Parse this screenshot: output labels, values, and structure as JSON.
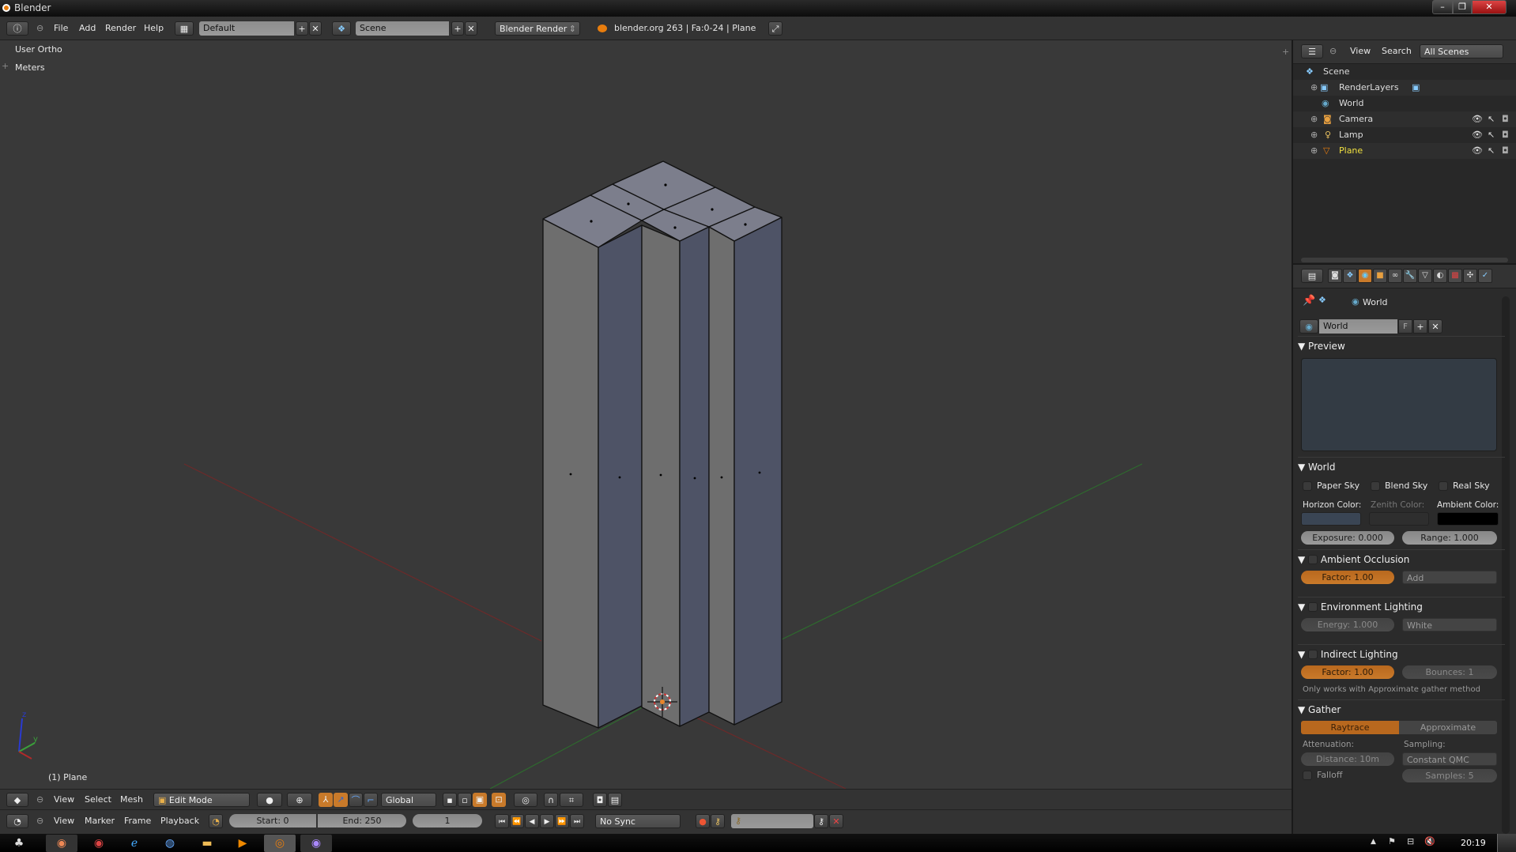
{
  "window": {
    "title": "Blender",
    "minimize": "–",
    "maximize": "❐",
    "close": "✕"
  },
  "info_header": {
    "menus": [
      "File",
      "Add",
      "Render",
      "Help"
    ],
    "screen_layout": "Default",
    "scene": "Scene",
    "render_engine": "Blender Render",
    "stats": "blender.org 263 | Fa:0-24 | Plane"
  },
  "viewport": {
    "view_name": "User Ortho",
    "units": "Meters",
    "object_label": "(1) Plane",
    "axis_labels": {
      "y": "y",
      "z": "z"
    }
  },
  "view3d_header": {
    "menus": [
      "View",
      "Select",
      "Mesh"
    ],
    "mode": "Edit Mode",
    "orientation": "Global"
  },
  "timeline": {
    "menus": [
      "View",
      "Marker",
      "Frame",
      "Playback"
    ],
    "start": "Start: 0",
    "end": "End: 250",
    "current_frame": "1",
    "sync": "No Sync"
  },
  "outliner": {
    "menus": [
      "View",
      "Search"
    ],
    "filter": "All Scenes",
    "items": [
      {
        "name": "Scene",
        "color": "#e6e6e6"
      },
      {
        "name": "RenderLayers",
        "color": "#e6e6e6"
      },
      {
        "name": "World",
        "color": "#e6e6e6"
      },
      {
        "name": "Camera",
        "color": "#e6e6e6"
      },
      {
        "name": "Lamp",
        "color": "#e6e6e6"
      },
      {
        "name": "Plane",
        "color": "#f0e040"
      }
    ]
  },
  "properties": {
    "breadcrumb": "World",
    "datablock_name": "World",
    "fake_user": "F",
    "panels": {
      "preview": "Preview",
      "world": "World",
      "ao": "Ambient Occlusion",
      "env": "Environment Lighting",
      "indirect": "Indirect Lighting",
      "gather": "Gather"
    },
    "world": {
      "paper_sky": "Paper Sky",
      "blend_sky": "Blend Sky",
      "real_sky": "Real Sky",
      "horizon_label": "Horizon Color:",
      "zenith_label": "Zenith Color:",
      "ambient_label": "Ambient Color:",
      "horizon_color": "#3a4554",
      "zenith_color": "#2e2e2e",
      "ambient_color": "#000000",
      "exposure": "Exposure: 0.000",
      "range": "Range: 1.000"
    },
    "ao": {
      "factor": "Factor: 1.00",
      "blend": "Add"
    },
    "env": {
      "energy": "Energy: 1.000",
      "color": "White"
    },
    "indirect": {
      "factor": "Factor: 1.00",
      "bounces": "Bounces: 1",
      "note": "Only works with Approximate gather method"
    },
    "gather": {
      "raytrace": "Raytrace",
      "approximate": "Approximate",
      "attenuation_label": "Attenuation:",
      "sampling_label": "Sampling:",
      "distance": "Distance: 10m",
      "sampling": "Constant QMC",
      "falloff": "Falloff",
      "samples": "Samples: 5"
    },
    "accent_color": "#c97a2a"
  },
  "taskbar": {
    "clock": "20:19"
  }
}
